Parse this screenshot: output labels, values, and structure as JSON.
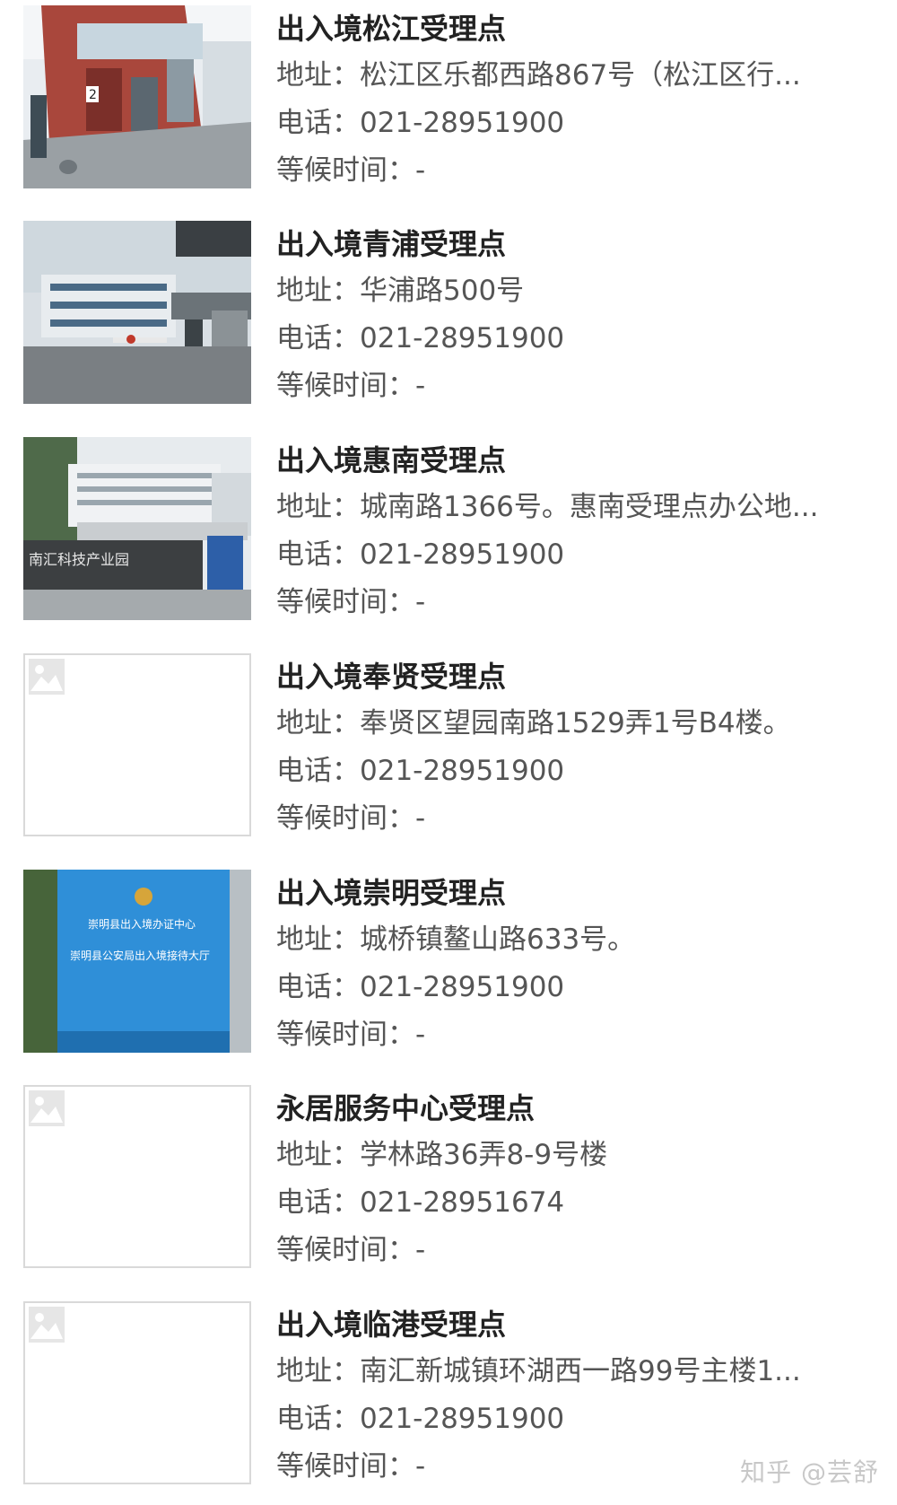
{
  "items": [
    {
      "title": "出入境松江受理点",
      "address": "地址：松江区乐都西路867号（松江区行...",
      "phone": "电话：021-28951900",
      "wait": "等候时间：-",
      "image": "building-photo"
    },
    {
      "title": "出入境青浦受理点",
      "address": "地址：华浦路500号",
      "phone": "电话：021-28951900",
      "wait": "等候时间：-",
      "image": "building-photo"
    },
    {
      "title": "出入境惠南受理点",
      "address": "地址：城南路1366号。惠南受理点办公地...",
      "phone": "电话：021-28951900",
      "wait": "等候时间：-",
      "image": "building-photo",
      "image_sign_text": "南汇科技产业园"
    },
    {
      "title": "出入境奉贤受理点",
      "address": "地址：奉贤区望园南路1529弄1号B4楼。",
      "phone": "电话：021-28951900",
      "wait": "等候时间：-",
      "image": "image-placeholder-icon"
    },
    {
      "title": "出入境崇明受理点",
      "address": "地址：城桥镇鳌山路633号。",
      "phone": "电话：021-28951900",
      "wait": "等候时间：-",
      "image": "sign-photo",
      "image_sign_text": [
        "崇明县出入境办证中心",
        "崇明县公安局出入境接待大厅"
      ]
    },
    {
      "title": "永居服务中心受理点",
      "address": "地址：学林路36弄8-9号楼",
      "phone": "电话：021-28951674",
      "wait": "等候时间：-",
      "image": "image-placeholder-icon"
    },
    {
      "title": "出入境临港受理点",
      "address": "地址：南汇新城镇环湖西一路99号主楼1...",
      "phone": "电话：021-28951900",
      "wait": "等候时间：-",
      "image": "image-placeholder-icon"
    }
  ],
  "watermark": "知乎 @芸舒",
  "colors": {
    "title": "#222222",
    "text": "#555555",
    "placeholder_border": "#d9d9d9",
    "sign_blue": "#2f8fd8"
  }
}
